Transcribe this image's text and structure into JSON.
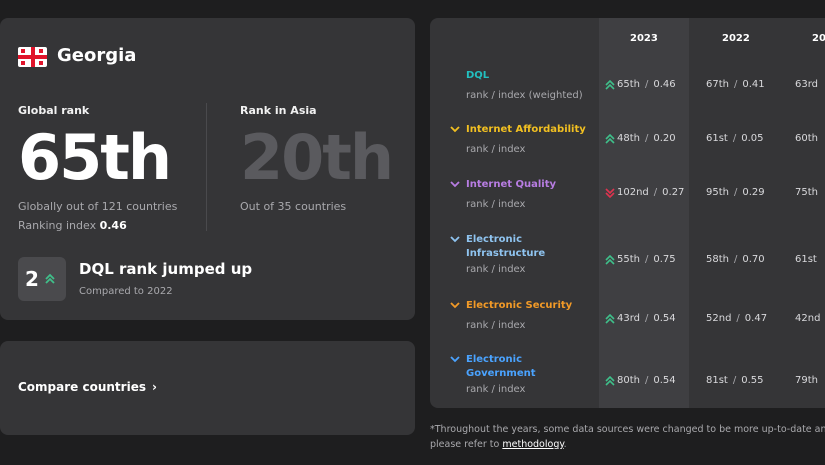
{
  "country": {
    "name": "Georgia",
    "flag_icon": "georgia-flag-icon"
  },
  "global": {
    "label": "Global rank",
    "value": "65th",
    "sub": "Globally out of 121 countries",
    "index_label": "Ranking index",
    "index_value": "0.46"
  },
  "asia": {
    "label": "Rank in Asia",
    "value": "20th",
    "sub": "Out of 35 countries"
  },
  "jump": {
    "number": "2",
    "direction": "up",
    "title": "DQL rank jumped up",
    "sub": "Compared to 2022"
  },
  "compare": {
    "label": "Compare countries"
  },
  "colors": {
    "up": "#3fbf8a",
    "down": "#e0334f",
    "accent_dql": "#22c0c0",
    "accent_affordability": "#f2c021",
    "accent_quality": "#b87de3",
    "accent_infrastructure": "#8fc4f0",
    "accent_security": "#f29a27",
    "accent_government": "#4aa3ff"
  },
  "table": {
    "years": [
      "2023",
      "2022",
      "20"
    ],
    "rows": [
      {
        "name": "DQL",
        "sub": "rank / index (weighted)",
        "color": "#22c0c0",
        "chevron": false,
        "trend": "up",
        "cells": [
          {
            "rank": "65th",
            "index": "0.46"
          },
          {
            "rank": "67th",
            "index": "0.41"
          },
          {
            "rank": "63rd",
            "index": ""
          }
        ]
      },
      {
        "name": "Internet Affordability",
        "sub": "rank / index",
        "color": "#f2c021",
        "chevron": true,
        "trend": "up",
        "cells": [
          {
            "rank": "48th",
            "index": "0.20"
          },
          {
            "rank": "61st",
            "index": "0.05"
          },
          {
            "rank": "60th",
            "index": ""
          }
        ]
      },
      {
        "name": "Internet Quality",
        "sub": "rank / index",
        "color": "#b87de3",
        "chevron": true,
        "trend": "down",
        "cells": [
          {
            "rank": "102nd",
            "index": "0.27"
          },
          {
            "rank": "95th",
            "index": "0.29"
          },
          {
            "rank": "75th",
            "index": ""
          }
        ]
      },
      {
        "name": "Electronic Infrastructure",
        "sub": "rank / index",
        "color": "#8fc4f0",
        "chevron": true,
        "trend": "up",
        "cells": [
          {
            "rank": "55th",
            "index": "0.75"
          },
          {
            "rank": "58th",
            "index": "0.70"
          },
          {
            "rank": "61st",
            "index": ""
          }
        ]
      },
      {
        "name": "Electronic Security",
        "sub": "rank / index",
        "color": "#f29a27",
        "chevron": true,
        "trend": "up",
        "cells": [
          {
            "rank": "43rd",
            "index": "0.54"
          },
          {
            "rank": "52nd",
            "index": "0.47"
          },
          {
            "rank": "42nd",
            "index": ""
          }
        ]
      },
      {
        "name": "Electronic Government",
        "sub": "rank / index",
        "color": "#4aa3ff",
        "chevron": true,
        "trend": "up",
        "cells": [
          {
            "rank": "80th",
            "index": "0.54"
          },
          {
            "rank": "81st",
            "index": "0.55"
          },
          {
            "rank": "79th",
            "index": ""
          }
        ]
      }
    ]
  },
  "footnote": {
    "line1": "*Throughout the years, some data sources were changed to be more up-to-date and acc",
    "line2_prefix": "please refer to ",
    "link": "methodology",
    "line2_suffix": "."
  }
}
